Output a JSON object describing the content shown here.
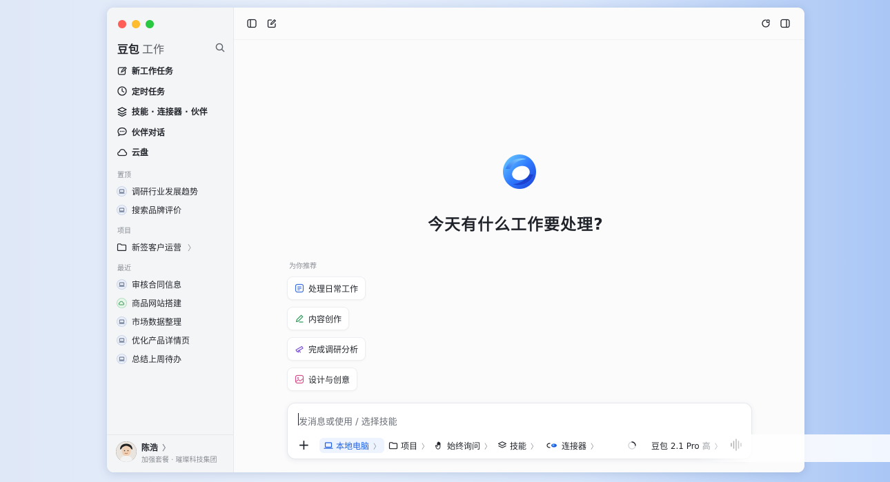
{
  "app": {
    "brand": "豆包",
    "brand_sub": "工作",
    "traffic_colors": [
      "#ff5f57",
      "#febc2e",
      "#28c840"
    ]
  },
  "nav": [
    {
      "label": "新工作任务",
      "icon": "edit-icon"
    },
    {
      "label": "定时任务",
      "icon": "clock-icon"
    },
    {
      "label": "技能 · 连接器 · 伙伴",
      "icon": "layers-icon"
    },
    {
      "label": "伙伴对话",
      "icon": "chat-icon"
    },
    {
      "label": "云盘",
      "icon": "cloud-icon"
    }
  ],
  "sections": {
    "pinned": {
      "label": "置顶",
      "items": [
        "调研行业发展趋势",
        "搜索品牌评价"
      ]
    },
    "projects": {
      "label": "项目",
      "items": [
        "新签客户运营"
      ],
      "chevron": "〉"
    },
    "recent": {
      "label": "最近",
      "items": [
        "审核合同信息",
        "商品网站搭建",
        "市场数据整理",
        "优化产品详情页",
        "总结上周待办"
      ]
    }
  },
  "user": {
    "name": "陈浩",
    "chevron": "〉",
    "plan": "加强套餐 · 璀璨科技集团"
  },
  "main": {
    "headline": "今天有什么工作要处理?",
    "recommend_label": "为你推荐",
    "chips": [
      {
        "label": "处理日常工作",
        "icon": "document-icon",
        "color": "#3b6fe0"
      },
      {
        "label": "内容创作",
        "icon": "pen-icon",
        "color": "#2f9e5b"
      },
      {
        "label": "完成调研分析",
        "icon": "telescope-icon",
        "color": "#7a4fd6"
      },
      {
        "label": "设计与创意",
        "icon": "image-icon",
        "color": "#d64f8a"
      }
    ]
  },
  "composer": {
    "placeholder": "发消息或使用 / 选择技能",
    "tools": [
      {
        "label": "本地电脑",
        "icon": "laptop-icon",
        "active": true
      },
      {
        "label": "项目",
        "icon": "folder-icon"
      },
      {
        "label": "始终询问",
        "icon": "hand-icon"
      },
      {
        "label": "技能",
        "icon": "layers-icon"
      },
      {
        "label": "连接器",
        "icon": "connector-icon"
      }
    ],
    "chevron": "〉",
    "model": "豆包 2.1 Pro",
    "model_suffix": "高",
    "accent": "#1f5fe0"
  }
}
